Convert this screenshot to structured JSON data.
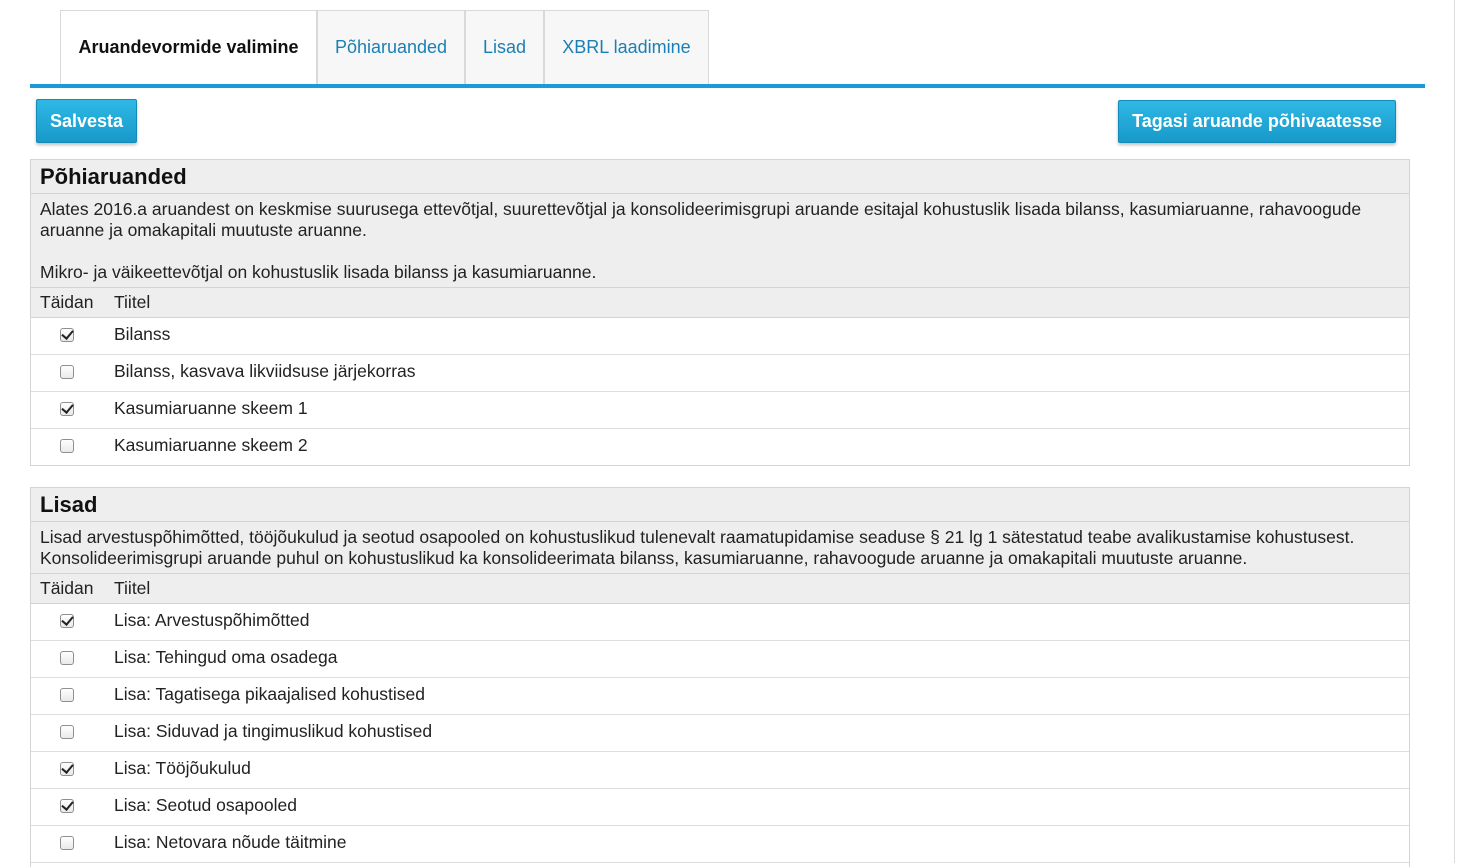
{
  "tabs": [
    {
      "label": "Aruandevormide valimine",
      "active": true
    },
    {
      "label": "Põhiaruanded",
      "active": false
    },
    {
      "label": "Lisad",
      "active": false
    },
    {
      "label": "XBRL laadimine",
      "active": false
    }
  ],
  "toolbar": {
    "save_label": "Salvesta",
    "back_label": "Tagasi aruande põhivaatesse"
  },
  "columns": {
    "fill": "Täidan",
    "title": "Tiitel"
  },
  "sections": [
    {
      "title": "Põhiaruanded",
      "description": [
        "Alates 2016.a aruandest on keskmise suurusega ettevõtjal, suurettevõtjal ja konsolideerimisgrupi aruande esitajal kohustuslik lisada bilanss, kasumiaruanne, rahavoogude aruanne ja omakapitali muutuste aruanne.",
        "Mikro- ja väikeettevõtjal on kohustuslik lisada bilanss ja kasumiaruanne."
      ],
      "rows": [
        {
          "label": "Bilanss",
          "checked": true
        },
        {
          "label": "Bilanss, kasvava likviidsuse järjekorras",
          "checked": false
        },
        {
          "label": "Kasumiaruanne skeem 1",
          "checked": true
        },
        {
          "label": "Kasumiaruanne skeem 2",
          "checked": false
        }
      ]
    },
    {
      "title": "Lisad",
      "description": [
        "Lisad arvestuspõhimõtted, tööjõukulud ja seotud osapooled on kohustuslikud tulenevalt raamatupidamise seaduse § 21 lg 1 sätestatud teabe avalikustamise kohustusest. Konsolideerimisgrupi aruande puhul on kohustuslikud ka konsolideerimata bilanss, kasumiaruanne, rahavoogude aruanne ja omakapitali muutuste aruanne."
      ],
      "rows": [
        {
          "label": "Lisa: Arvestuspõhimõtted",
          "checked": true
        },
        {
          "label": "Lisa: Tehingud oma osadega",
          "checked": false
        },
        {
          "label": "Lisa: Tagatisega pikaajalised kohustised",
          "checked": false
        },
        {
          "label": "Lisa: Siduvad ja tingimuslikud kohustised",
          "checked": false
        },
        {
          "label": "Lisa: Tööjõukulud",
          "checked": true
        },
        {
          "label": "Lisa: Seotud osapooled",
          "checked": true
        },
        {
          "label": "Lisa: Netovara nõude täitmine",
          "checked": false
        }
      ]
    }
  ]
}
